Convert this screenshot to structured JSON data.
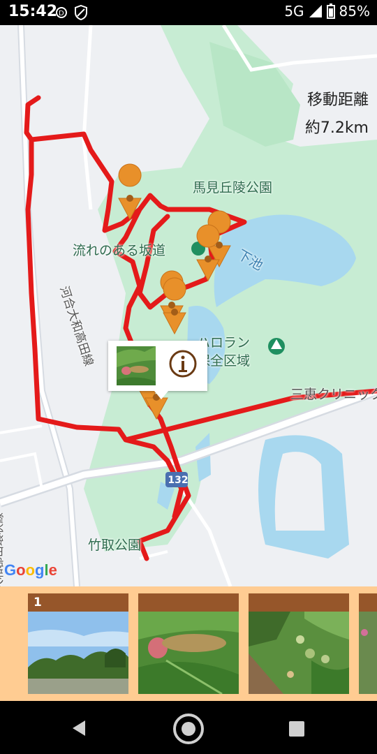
{
  "status_bar": {
    "time": "15:42",
    "network": "5G",
    "battery": "85%",
    "icons": [
      "sync-icon",
      "shield-icon",
      "signal-icon",
      "battery-icon"
    ]
  },
  "map": {
    "distance_label": "移動距離",
    "distance_value": "約7.2km",
    "place_labels": {
      "park": "馬見丘陵公園",
      "slope_path": "流れのある坂道",
      "pond": "下池",
      "line_road": "河合大和高田線",
      "reserve_line1": "ハロラン",
      "reserve_line2": "保全区域",
      "clinic": "三恵クリニック",
      "taketori": "竹取公園",
      "route_shield": "132",
      "ring_road": "大和郡山環状線"
    },
    "attribution": "Google",
    "popup": {
      "thumbnail": "magnolia-fruit-photo",
      "info_icon": "info-icon"
    },
    "colors": {
      "route": "#e41a1a",
      "marker": "#e8902a",
      "park_green": "#c7ecd3",
      "water": "#a8d8ef"
    }
  },
  "photo_strip": {
    "cards": [
      {
        "badge": "1",
        "photo": "park-tree-sky-photo"
      },
      {
        "badge": "",
        "photo": "magnolia-fruit-photo"
      },
      {
        "badge": "",
        "photo": "magnolia-plant-photo"
      },
      {
        "badge": "",
        "photo": "partial-photo"
      }
    ]
  },
  "nav_bar": {
    "buttons": [
      "back-icon",
      "home-icon",
      "recents-icon"
    ]
  }
}
